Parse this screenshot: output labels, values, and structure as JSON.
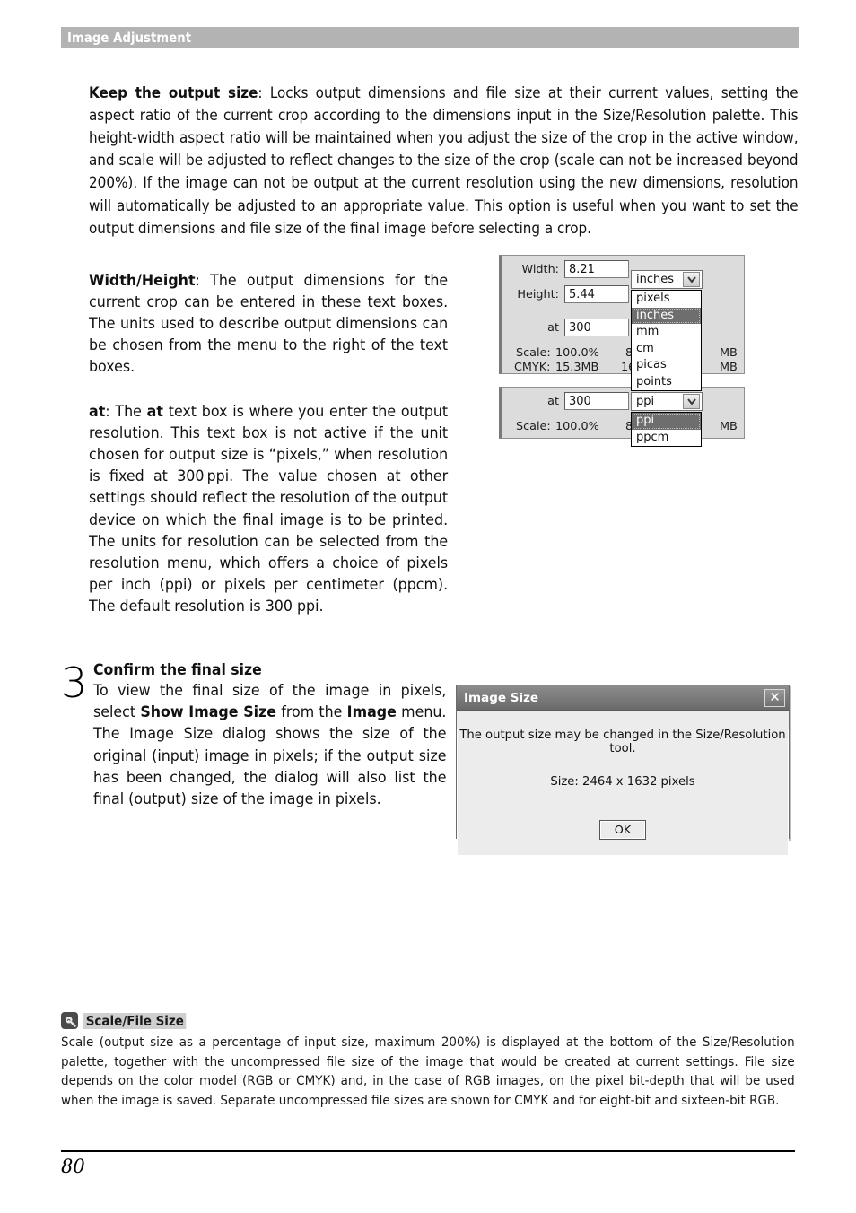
{
  "header": {
    "title": "Image Adjustment"
  },
  "paragraphs": {
    "keep_output_size": {
      "term": "Keep the output size",
      "text": ": Locks output dimensions and file size at their current values, setting the aspect ratio of the current crop according to the dimensions input in the Size/Resolution palette. This height-width aspect ratio will be maintained when you adjust the size of the crop in the active window, and scale will be adjusted to reflect changes to the size of the crop (scale can not be increased beyond 200%). If the image can not be output at the current resolution using the new dimensions, resolution will automatically be adjusted to an appropriate value. This option is useful when you want to set the output dimensions and file size of the final image before selecting a crop."
    },
    "width_height": {
      "term": "Width/Height",
      "text": ": The output dimensions for the current crop can be entered in these text boxes. The units used to describe output dimensions can be chosen from the menu to the right of the text boxes."
    },
    "at": {
      "term": "at",
      "part1": ": The ",
      "term2": "at",
      "part2": " text box is where you enter the output resolution. This text box is not active if the unit chosen for output size is “pixels,” when resolution is fixed at 300 ppi. The value chosen at other settings should reflect the resolution of the output device on which the final image is to be printed. The units for resolution can be selected from the resolution menu, which offers a choice of pixels per inch (ppi) or pixels per centimeter (ppcm). The default resolution is 300 ppi."
    }
  },
  "step": {
    "number": "3",
    "heading": "Confirm the final size",
    "part1": "To view the final size of the image in pixels, select ",
    "bold1": "Show Image Size",
    "part2": " from the ",
    "bold2": "Image",
    "part3": " menu. The Image Size dialog shows the size of the original (input) image in pixels; if the output size has been changed, the dialog will also list the final (output) size of the image in pixels."
  },
  "palette_size": {
    "width_label": "Width:",
    "width_value": "8.21",
    "height_label": "Height:",
    "height_value": "5.44",
    "at_label": "at",
    "at_value": "300",
    "scale_label": "Scale:",
    "scale_value": "100.0%",
    "bit8_label": "8-",
    "bit8_mb": "MB",
    "cmyk_label": "CMYK:",
    "cmyk_value": "15.3MB",
    "bit16_label": "16-",
    "bit16_mb": "MB",
    "unit_combo_value": "inches",
    "unit_options": [
      "pixels",
      "inches",
      "mm",
      "cm",
      "picas",
      "points"
    ],
    "unit_selected": "inches"
  },
  "palette_res": {
    "at_label": "at",
    "at_value": "300",
    "scale_label": "Scale:",
    "scale_value": "100.0%",
    "bit8_label": "8-",
    "bit8_mb": "MB",
    "res_combo_value": "ppi",
    "res_options": [
      "ppi",
      "ppcm"
    ],
    "res_selected": "ppi"
  },
  "dialog": {
    "title": "Image Size",
    "close_glyph": "✕",
    "message": "The output size may be changed in the Size/Resolution tool.",
    "size_line": "Size:  2464 x 1632 pixels",
    "ok_label": "OK"
  },
  "note": {
    "title": "Scale/File Size",
    "body": "Scale (output size as a percentage of input size, maximum 200%) is displayed at the bottom of the Size/Resolution palette, together with the uncompressed file size of the image that would be created at current settings. File size depends on the color model (RGB or CMYK) and, in the case of RGB images, on the pixel bit-depth that will be used when the image is saved. Separate uncompressed file sizes are shown for CMYK and for eight-bit and sixteen-bit RGB."
  },
  "footer": {
    "page_number": "80"
  },
  "colors": {
    "header_bar": "#b3b3b3",
    "palette_bg": "#dcdcdc",
    "dropdown_selected": "#6e6e6e",
    "dialog_titlebar": "#7a7a7a"
  }
}
